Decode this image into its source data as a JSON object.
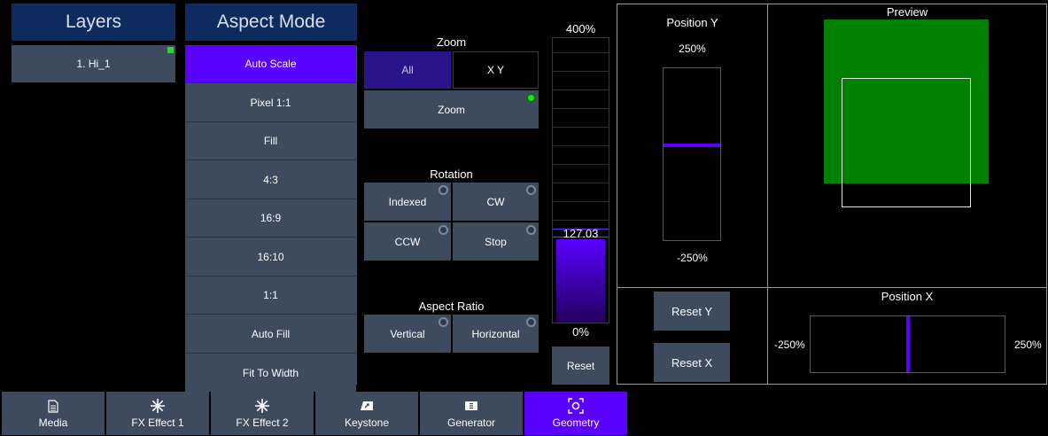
{
  "layers": {
    "header": "Layers",
    "items": [
      {
        "label": "1. Hi_1"
      }
    ]
  },
  "aspect_mode": {
    "header": "Aspect Mode",
    "selected": "Auto Scale",
    "items": [
      "Auto Scale",
      "Pixel 1:1",
      "Fill",
      "4:3",
      "16:9",
      "16:10",
      "1:1",
      "Auto Fill",
      "Fit To Width"
    ]
  },
  "zoom": {
    "title": "Zoom",
    "all_label": "All",
    "xy_label": "X Y",
    "zoom_label": "Zoom"
  },
  "rotation": {
    "title": "Rotation",
    "indexed_label": "Indexed",
    "cw_label": "CW",
    "ccw_label": "CCW",
    "stop_label": "Stop"
  },
  "aspect_ratio": {
    "title": "Aspect Ratio",
    "vertical_label": "Vertical",
    "horizontal_label": "Horizontal"
  },
  "zoom_slider": {
    "max_label": "400%",
    "min_label": "0%",
    "value_label": "127.03",
    "fraction": 0.3176,
    "reset_label": "Reset"
  },
  "position_y": {
    "title": "Position Y",
    "max_label": "250%",
    "min_label": "-250%",
    "fraction": 0.56
  },
  "position_x": {
    "title": "Position X",
    "min_label": "-250%",
    "max_label": "250%",
    "fraction": 0.5
  },
  "preview": {
    "title": "Preview"
  },
  "reset_y_label": "Reset Y",
  "reset_x_label": "Reset X",
  "tabs": [
    {
      "label": "Media",
      "icon": "document-icon"
    },
    {
      "label": "FX Effect 1",
      "icon": "sparkle-icon"
    },
    {
      "label": "FX Effect 2",
      "icon": "sparkle-icon"
    },
    {
      "label": "Keystone",
      "icon": "keystone-icon"
    },
    {
      "label": "Generator",
      "icon": "generator-icon"
    },
    {
      "label": "Geometry",
      "icon": "geometry-icon"
    }
  ],
  "selected_tab": "Geometry",
  "colors": {
    "accent": "#5a00ff",
    "header_bg": "#0f2a5e",
    "button_bg": "#3e4a5e",
    "preview_fill": "#008000",
    "led_on": "#19e21f"
  }
}
